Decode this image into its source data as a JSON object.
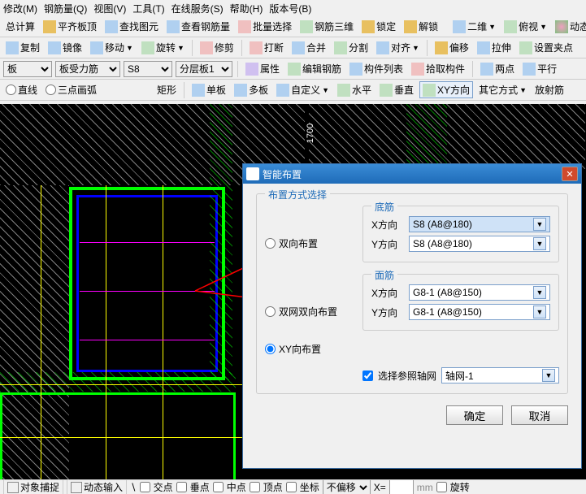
{
  "menubar": [
    "修改(M)",
    "钢筋量(Q)",
    "视图(V)",
    "工具(T)",
    "在线服务(S)",
    "帮助(H)",
    "版本号(B)"
  ],
  "toolbar1": {
    "calc": "总计算",
    "level": "平齐板顶",
    "find": "查找图元",
    "rebar_qty": "查看钢筋量",
    "batch_sel": "批量选择",
    "rebar3d": "钢筋三维",
    "lock": "锁定",
    "unlock": "解锁",
    "dim2d": "二维",
    "view_top": "俯视",
    "dyn_obs": "动态观"
  },
  "toolbar2": {
    "copy": "复制",
    "mirror": "镜像",
    "move": "移动",
    "rotate": "旋转",
    "trim": "修剪",
    "break": "打断",
    "merge": "合并",
    "split": "分割",
    "align": "对齐",
    "offset": "偏移",
    "stretch": "拉伸",
    "set_grip": "设置夹点"
  },
  "toolbar3": {
    "sel_board": "板",
    "sel_rebar": "板受力筋",
    "sel_size": "S8",
    "sel_layer": "分层板1",
    "prop": "属性",
    "edit_rebar": "编辑钢筋",
    "member_list": "构件列表",
    "pick_member": "拾取构件",
    "two_pt": "两点",
    "parallel": "平行"
  },
  "toolbar4": {
    "line": "直线",
    "arc3": "三点画弧",
    "rect": "矩形",
    "single": "单板",
    "multi": "多板",
    "custom": "自定义",
    "horiz": "水平",
    "vert": "垂直",
    "xy": "XY方向",
    "other": "其它方式",
    "radial": "放射筋"
  },
  "canvas": {
    "dim_1700": "1700"
  },
  "dialog": {
    "title": "智能布置",
    "group_title": "布置方式选择",
    "radio_bidir": "双向布置",
    "radio_dual_bidir": "双网双向布置",
    "radio_xy": "XY向布置",
    "bottom_group": "底筋",
    "top_group": "面筋",
    "x_label": "X方向",
    "y_label": "Y方向",
    "bottom_x_val": "S8 (A8@180)",
    "bottom_y_val": "S8 (A8@180)",
    "top_x_val": "G8-1 (A8@150)",
    "top_y_val": "G8-1 (A8@150)",
    "ref_grid_check": "选择参照轴网",
    "ref_grid_val": "轴网-1",
    "ok": "确定",
    "cancel": "取消"
  },
  "statusbar": {
    "snap": "对象捕捉",
    "dyn_input": "动态输入",
    "cross": "交点",
    "perp": "垂点",
    "mid": "中点",
    "top": "顶点",
    "coord": "坐标",
    "no_offset": "不偏移",
    "x": "X=",
    "rotate": "旋转"
  }
}
